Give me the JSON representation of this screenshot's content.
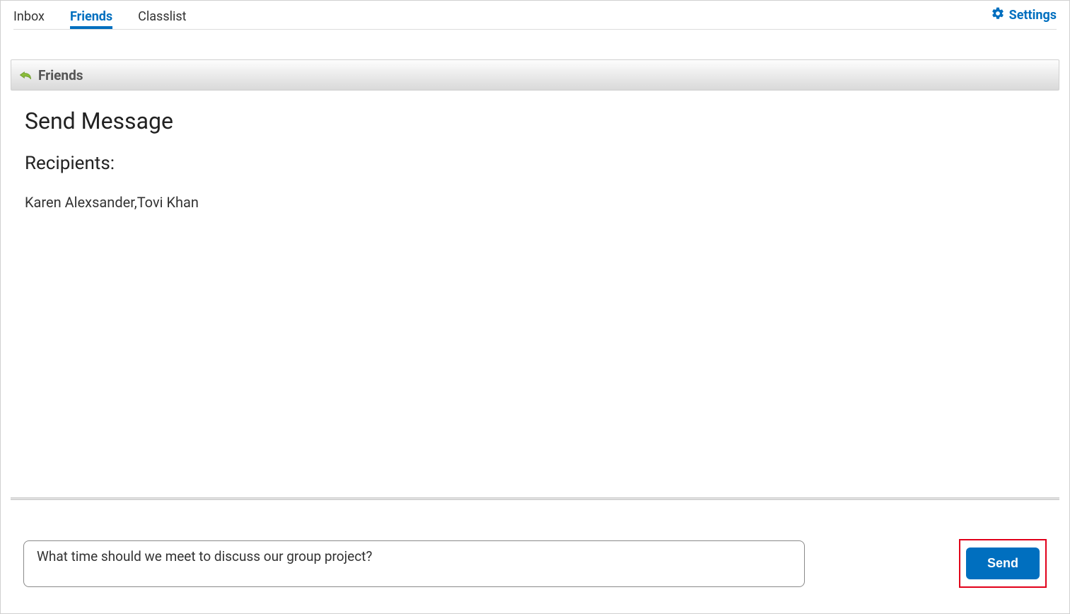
{
  "nav": {
    "tabs": [
      {
        "label": "Inbox",
        "active": false
      },
      {
        "label": "Friends",
        "active": true
      },
      {
        "label": "Classlist",
        "active": false
      }
    ],
    "settings_label": "Settings"
  },
  "breadcrumb": {
    "label": "Friends"
  },
  "page": {
    "title": "Send Message",
    "recipients_label": "Recipients:",
    "recipients_value": "Karen Alexsander,Tovi Khan"
  },
  "compose": {
    "message_value": "What time should we meet to discuss our group project?",
    "send_label": "Send"
  }
}
